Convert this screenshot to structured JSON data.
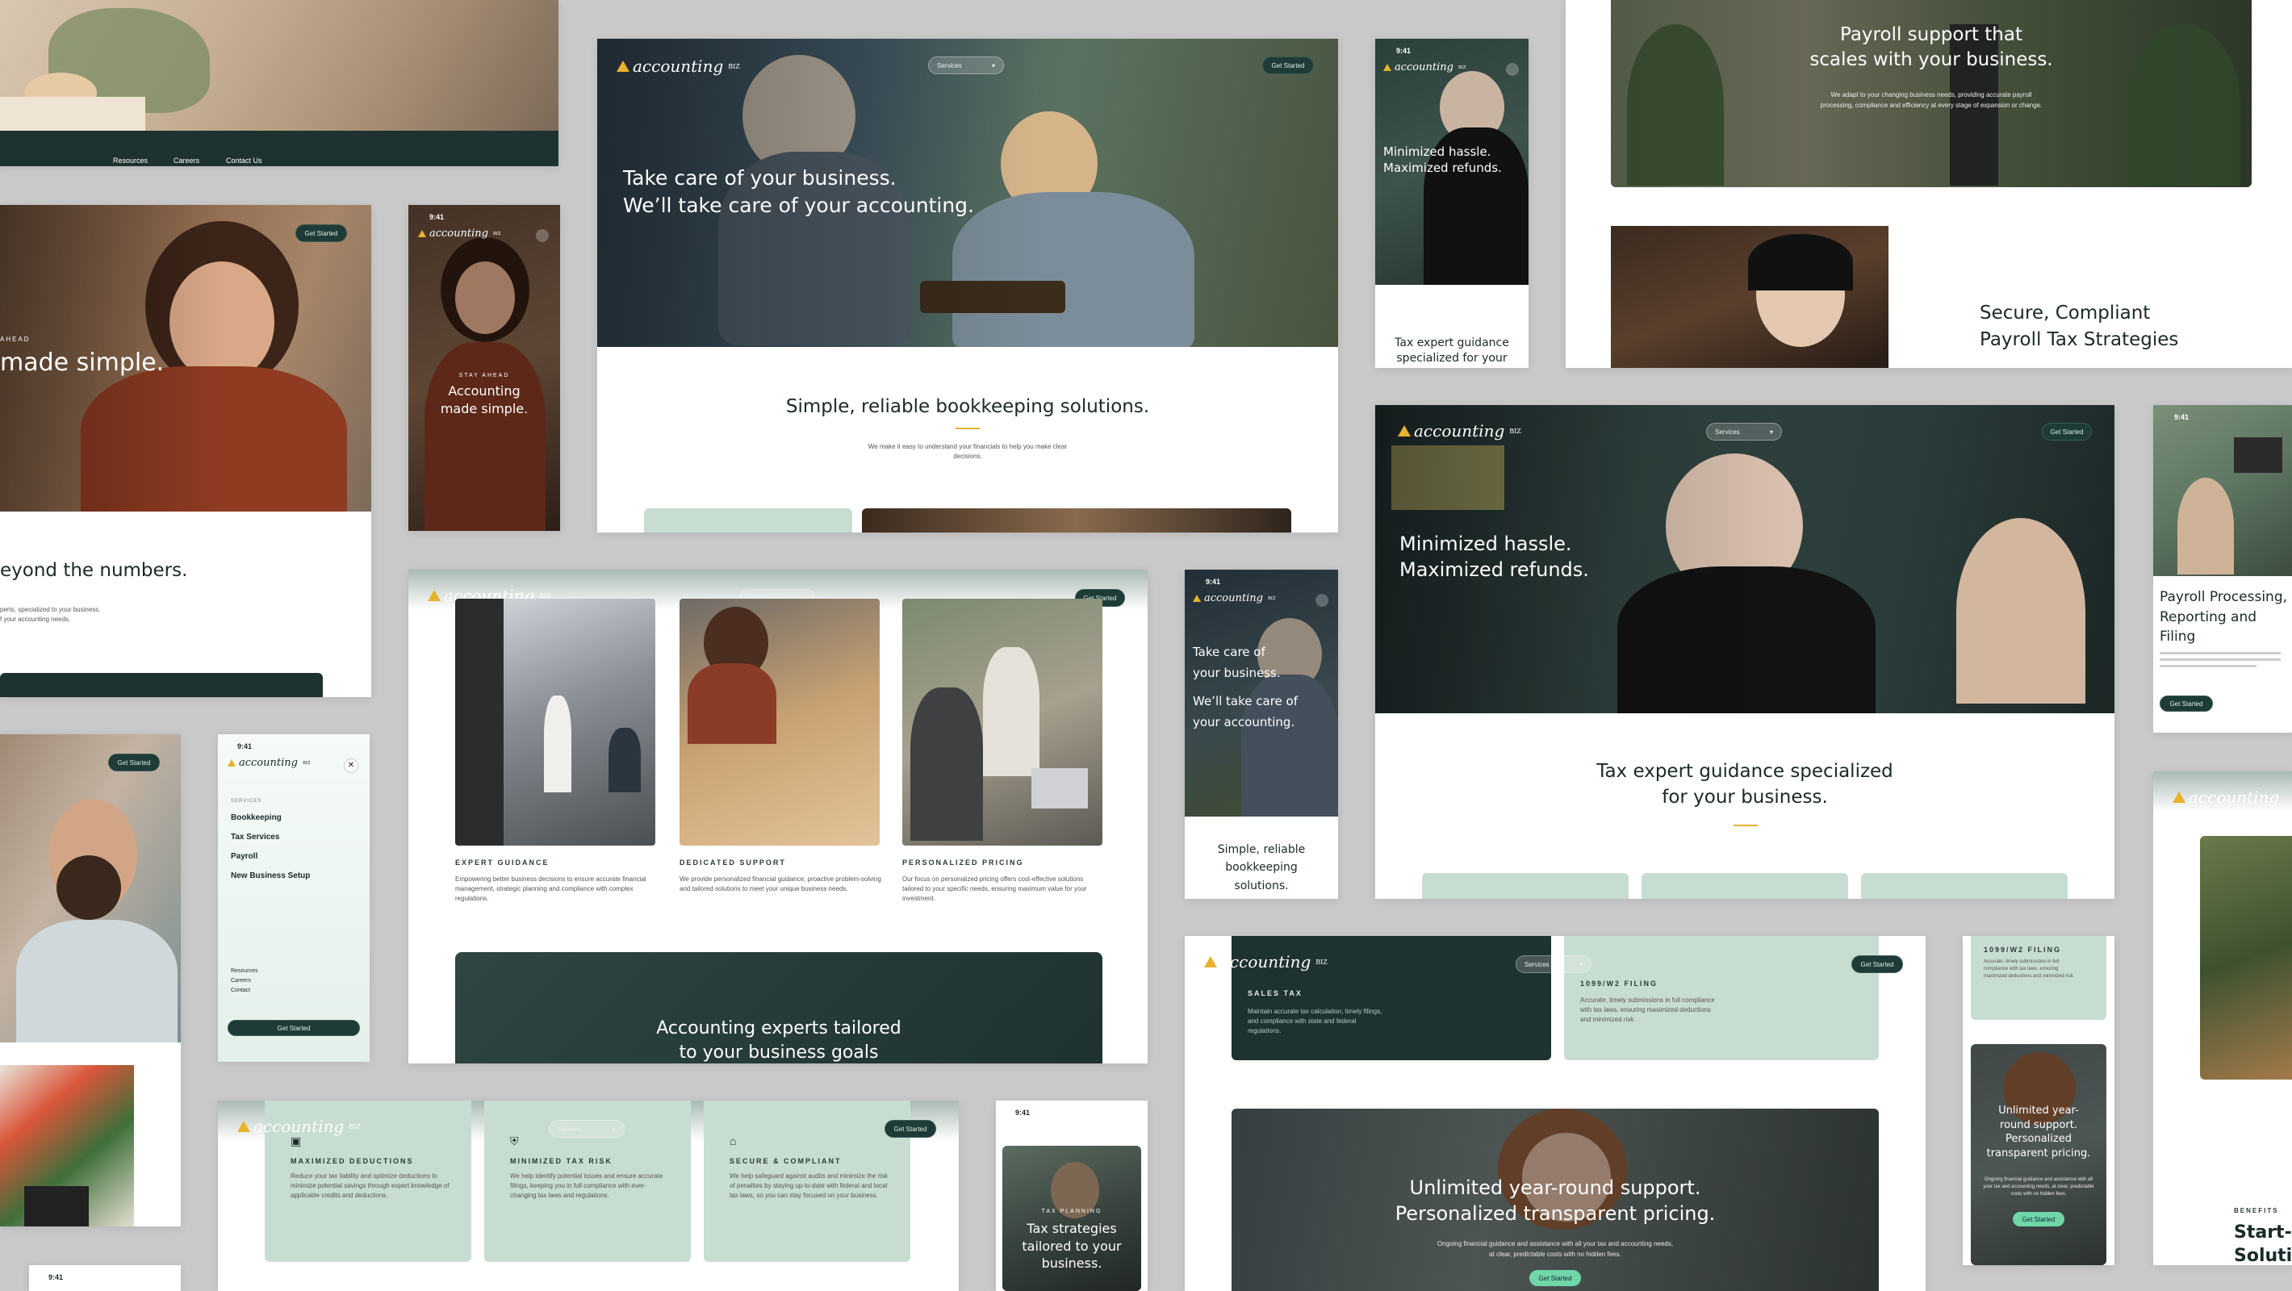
{
  "brand": {
    "logo_text": "accounting",
    "logo_sup": "BIZ",
    "colors": {
      "accent": "#e7b22c",
      "deep_green": "#1e3230",
      "mint": "#c8ddd1"
    }
  },
  "top_left": {
    "nav": [
      "Resources",
      "Careers",
      "Contact Us"
    ]
  },
  "hero_main": {
    "services_label": "Services",
    "cta": "Get Started",
    "headline_1": "Take care of your business.",
    "headline_2": "We’ll take care of your accounting.",
    "section_title": "Simple, reliable bookkeeping solutions.",
    "section_body_1": "We make it easy to understand your financials to help you make clear",
    "section_body_2": "decisions."
  },
  "phone_minimized": {
    "time": "9:41",
    "headline_1": "Minimized hassle.",
    "headline_2": "Maximized refunds.",
    "section_1": "Tax expert guidance",
    "section_2": "specialized for your"
  },
  "payroll_top": {
    "headline_1": "Payroll support that",
    "headline_2": "scales with your business.",
    "body_1": "We adapt to your changing business needs, providing accurate payroll",
    "body_2": "processing, compliance and efficiency at every stage of expansion or change."
  },
  "secure_card": {
    "title_1": "Secure, Compliant",
    "title_2": "Payroll Tax Strategies"
  },
  "simple_card": {
    "cta": "Get Started",
    "headline": "made simple.",
    "eyebrow": "AHEAD",
    "section_title": "eyond the numbers.",
    "body_1": "perts, specialized to your business.",
    "body_2": "f your accounting needs."
  },
  "phone_simple": {
    "time": "9:41",
    "eyebrow": "STAY AHEAD",
    "headline_1": "Accounting",
    "headline_2": "made simple."
  },
  "minimized_desktop": {
    "services_label": "Services",
    "cta": "Get Started",
    "headline_1": "Minimized hassle.",
    "headline_2": "Maximized refunds.",
    "section_title_1": "Tax expert guidance specialized",
    "section_title_2": "for your business."
  },
  "payroll_right": {
    "time": "9:41",
    "title_1": "Payroll Processing,",
    "title_2": "Reporting and",
    "title_3": "Filing",
    "cta": "Get Started"
  },
  "features_card": {
    "services_label": "Services",
    "cta": "Get Started",
    "items": [
      {
        "title": "EXPERT GUIDANCE",
        "body": "Empowering better business decisions to ensure accurate financial management, strategic planning and compliance with complex regulations."
      },
      {
        "title": "DEDICATED SUPPORT",
        "body": "We provide personalized financial guidance, proactive problem-solving and tailored solutions to meet your unique business needs."
      },
      {
        "title": "PERSONALIZED PRICING",
        "body": "Our focus on personalized pricing offers cost-effective solutions tailored to your specific needs, ensuring maximum value for your investment."
      }
    ],
    "banner_1": "Accounting experts tailored",
    "banner_2": "to your business goals"
  },
  "phone_take_care": {
    "time": "9:41",
    "headline_1": "Take care of",
    "headline_2": "your business.",
    "headline_3": "We’ll take care of",
    "headline_4": "your accounting.",
    "section_1": "Simple, reliable",
    "section_2": "bookkeeping",
    "section_3": "solutions."
  },
  "phone_menu": {
    "time": "9:41",
    "section_label": "SERVICES",
    "items": [
      "Bookkeeping",
      "Tax Services",
      "Payroll",
      "New Business Setup"
    ],
    "secondary": [
      "Resources",
      "Careers",
      "Contact"
    ],
    "cta": "Get Started"
  },
  "left_man": {
    "cta": "Get Started"
  },
  "deductions_card": {
    "services_label": "Services",
    "cta": "Get Started",
    "items": [
      {
        "title": "MAXIMIZED DEDUCTIONS",
        "body": "Reduce your tax liability and optimize deductions to minimize potential savings through expert knowledge of applicable credits and deductions."
      },
      {
        "title": "MINIMIZED TAX RISK",
        "body": "We help identify potential issues and ensure accurate filings, keeping you in full compliance with ever-changing tax laws and regulations."
      },
      {
        "title": "SECURE & COMPLIANT",
        "body": "We help safeguard against audits and minimize the risk of penalties by staying up-to-date with federal and local tax laws, so you can stay focused on your business."
      }
    ]
  },
  "phone_tax_strategies": {
    "time": "9:41",
    "eyebrow": "TAX PLANNING",
    "headline_1": "Tax strategies",
    "headline_2": "tailored to your",
    "headline_3": "business."
  },
  "support_card": {
    "services_label": "Services",
    "cta": "Get Started",
    "sales_tax_title": "SALES TAX",
    "sales_tax_body": "Maintain accurate tax calculation, timely filings, and compliance with state and federal regulations.",
    "filing_title": "1099/W2 FILING",
    "filing_body": "Accurate, timely submissions in full compliance with tax laws, ensuring maximized deductions and minimized risk.",
    "headline_1": "Unlimited year-round support.",
    "headline_2": "Personalized transparent pricing.",
    "body_1": "Ongoing financial guidance and assistance with all your tax and accounting needs,",
    "body_2": "at clear, predictable costs with no hidden fees.",
    "cta2": "Get Started"
  },
  "phone_support": {
    "filing_title": "1099/W2 FILING",
    "filing_body": "Accurate, timely submissions in full compliance with tax laws, ensuring maximized deductions and minimized risk.",
    "headline_1": "Unlimited year-",
    "headline_2": "round support.",
    "headline_3": "Personalized",
    "headline_4": "transparent pricing.",
    "body": "Ongoing financial guidance and assistance with all your tax and accounting needs, at clear, predictable costs with no hidden fees.",
    "cta": "Get Started"
  },
  "right_edge": {
    "eyebrow": "BENEFITS",
    "headline_1": "Start-",
    "headline_2": "Soluti"
  },
  "bottom_phone": {
    "time": "9:41"
  }
}
